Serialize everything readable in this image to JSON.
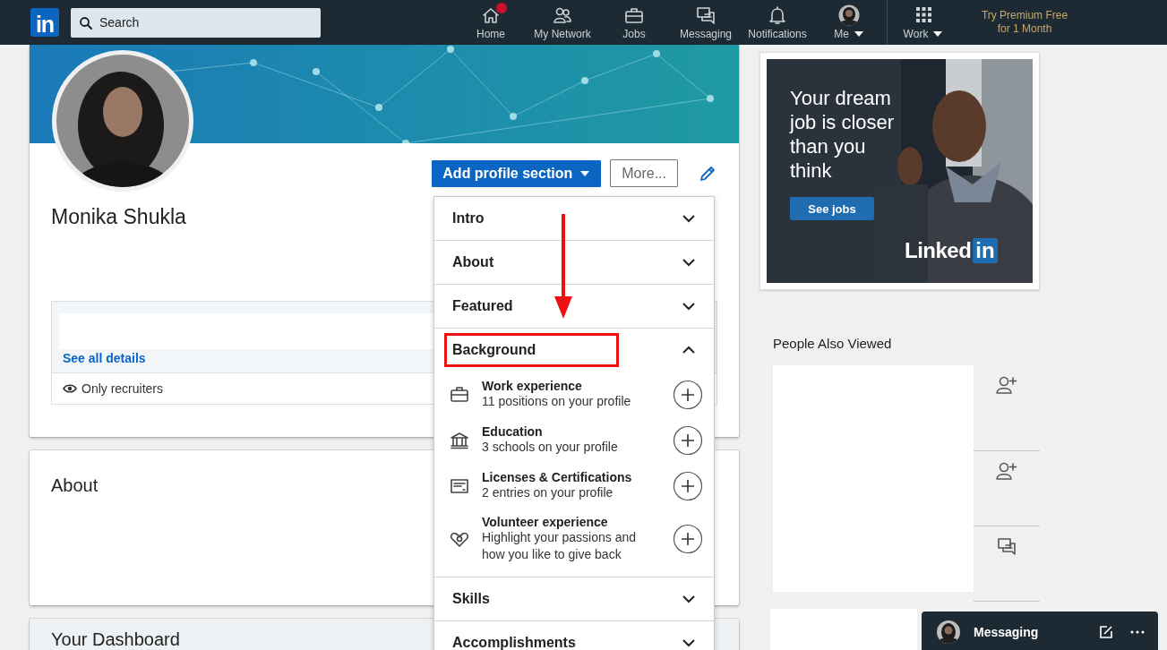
{
  "nav": {
    "logo": "in",
    "search": {
      "placeholder": "Search"
    },
    "items": [
      {
        "kind": "home",
        "label": "Home",
        "has_notification": true
      },
      {
        "kind": "network",
        "label": "My Network",
        "has_notification": false
      },
      {
        "kind": "jobs",
        "label": "Jobs",
        "has_notification": false
      },
      {
        "kind": "messaging",
        "label": "Messaging",
        "has_notification": false
      },
      {
        "kind": "notifications",
        "label": "Notifications",
        "has_notification": false
      },
      {
        "kind": "me",
        "label": "Me",
        "has_notification": false
      },
      {
        "kind": "work",
        "label": "Work",
        "has_notification": false
      }
    ],
    "premium": "Try Premium Free for 1 Month"
  },
  "profile": {
    "name": "Monika Shukla",
    "add_section_button": "Add profile section",
    "more_button": "More...",
    "see_all": "See all details",
    "visibility": "Only recruiters"
  },
  "sections": [
    {
      "title": "About"
    },
    {
      "title": "Your Dashboard"
    }
  ],
  "add_section_menu": [
    {
      "label": "Intro",
      "expanded": false,
      "highlighted": false
    },
    {
      "label": "About",
      "expanded": false,
      "highlighted": false
    },
    {
      "label": "Featured",
      "expanded": false,
      "highlighted": false
    },
    {
      "label": "Background",
      "expanded": true,
      "highlighted": true,
      "children": [
        {
          "kind": "briefcase",
          "title": "Work experience",
          "subtitle": "11 positions on your profile"
        },
        {
          "kind": "institution",
          "title": "Education",
          "subtitle": "3 schools on your profile"
        },
        {
          "kind": "certificate",
          "title": "Licenses & Certifications",
          "subtitle": "2 entries on your profile"
        },
        {
          "kind": "heart",
          "title": "Volunteer experience",
          "subtitle": "Highlight your passions and how you like to give back"
        }
      ]
    },
    {
      "label": "Skills",
      "expanded": false,
      "highlighted": false
    },
    {
      "label": "Accomplishments",
      "expanded": false,
      "highlighted": false
    }
  ],
  "ad": {
    "headline": "Your dream job is closer than you think",
    "button": "See jobs",
    "logo_word": "Linked",
    "logo_badge": "in"
  },
  "people_also_viewed": {
    "heading": "People Also Viewed",
    "actions": [
      {
        "kind": "connect"
      },
      {
        "kind": "connect"
      },
      {
        "kind": "message"
      }
    ]
  },
  "messaging_bar": {
    "label": "Messaging"
  }
}
